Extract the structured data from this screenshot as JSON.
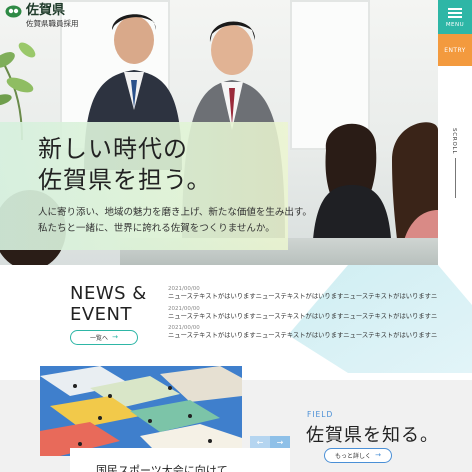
{
  "logo": {
    "name": "佐賀県",
    "subtitle": "佐賀県職員採用"
  },
  "menu": {
    "label": "MENU"
  },
  "entry": {
    "label": "ENTRY"
  },
  "scroll": {
    "label": "SCROLL"
  },
  "hero": {
    "title_line1": "新しい時代の",
    "title_line2": "佐賀県を担う。",
    "sub_line1": "人に寄り添い、地域の魅力を磨き上げ、新たな価値を生み出す。",
    "sub_line2": "私たちと一緒に、世界に誇れる佐賀をつくりませんか。"
  },
  "news": {
    "title_line1": "NEWS &",
    "title_line2": "EVENT",
    "more_label": "一覧へ",
    "items": [
      {
        "date": "2021/00/00",
        "text": "ニューステキストがはいりますニューステキストがはいりますニューステキストがはいりますニューステキスト"
      },
      {
        "date": "2021/00/00",
        "text": "ニューステキストがはいりますニューステキストがはいりますニューステキストがはいりますニューステキスト"
      },
      {
        "date": "2021/00/00",
        "text": "ニューステキストがはいりますニューステキストがはいりますニューステキストがはいりますニューステキスト"
      }
    ]
  },
  "field": {
    "label": "FIELD",
    "heading": "佐賀県を知る。",
    "more_label": "もっと詳しく",
    "card_title": "国民スポーツ大会に向けて"
  },
  "colors": {
    "accent": "#2eb6a6",
    "entry": "#f39a3e",
    "field_blue": "#4a8fd6"
  }
}
